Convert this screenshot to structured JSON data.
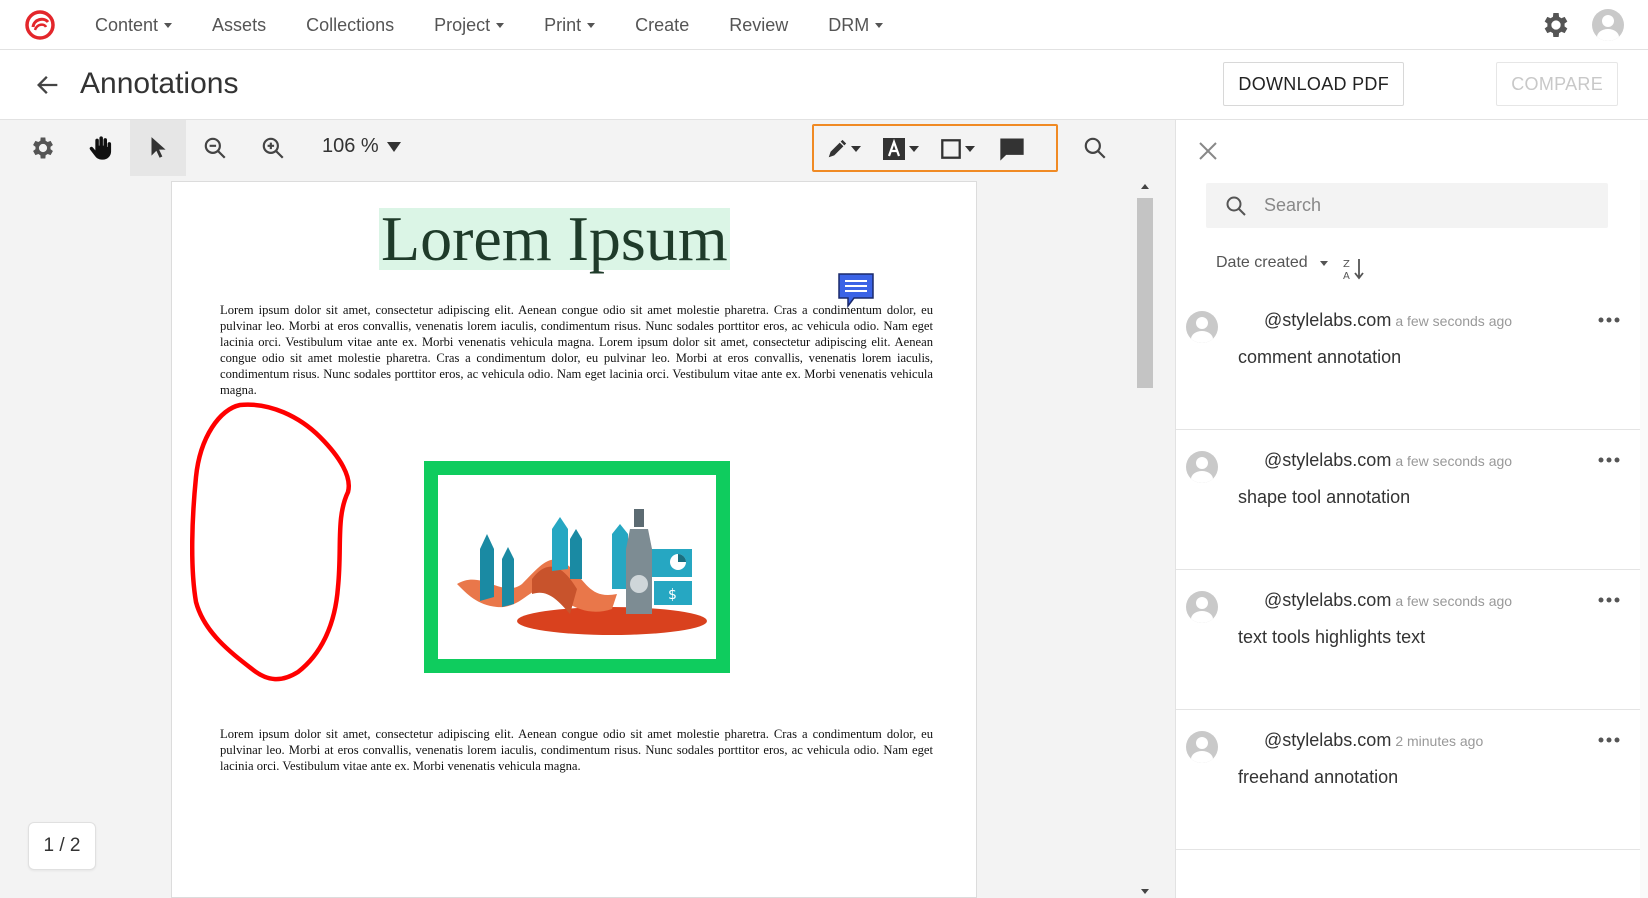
{
  "colors": {
    "logo": "#e3262b",
    "annotation_tools_border": "#f08a24",
    "highlight": "#dbf5e6",
    "freehand": "#ff0000",
    "shape_frame": "#0fcc5e",
    "comment_marker": "#3b63e6"
  },
  "nav": {
    "items": [
      {
        "label": "Content",
        "dropdown": true
      },
      {
        "label": "Assets",
        "dropdown": false
      },
      {
        "label": "Collections",
        "dropdown": false
      },
      {
        "label": "Project",
        "dropdown": true
      },
      {
        "label": "Print",
        "dropdown": true
      },
      {
        "label": "Create",
        "dropdown": false
      },
      {
        "label": "Review",
        "dropdown": false
      },
      {
        "label": "DRM",
        "dropdown": true
      }
    ],
    "icons": [
      "gear-icon",
      "user-avatar-icon"
    ]
  },
  "header": {
    "title": "Annotations",
    "download_label": "DOWNLOAD PDF",
    "compare_label": "COMPARE"
  },
  "toolbar": {
    "zoom": "106 %",
    "icons": [
      "gear-icon",
      "hand-icon",
      "pointer-icon",
      "zoom-out-icon",
      "zoom-in-icon",
      "pen-icon",
      "text-tool-icon",
      "rectangle-icon",
      "comment-icon",
      "search-icon"
    ]
  },
  "document": {
    "title": "Lorem Ipsum",
    "paragraph1": "Lorem ipsum dolor sit amet, consectetur adipiscing elit. Aenean congue odio sit amet molestie pharetra. Cras a condimentum dolor, eu pulvinar leo. Morbi at eros convallis, venenatis lorem iaculis, condimentum risus. Nunc sodales porttitor eros, ac vehicula odio. Nam eget lacinia orci. Vestibulum vitae ante ex. Morbi venenatis vehicula magna. Lorem ipsum dolor sit amet, consectetur adipiscing elit. Aenean congue odio sit amet molestie pharetra. Cras a condimentum dolor, eu pulvinar leo. Morbi at eros convallis, venenatis lorem iaculis, condimentum risus. Nunc sodales porttitor eros, ac vehicula odio. Nam eget lacinia orci. Vestibulum vitae ante ex. Morbi venenatis vehicula magna.",
    "paragraph2": "Lorem ipsum dolor sit amet, consectetur adipiscing elit. Aenean congue odio sit amet molestie pharetra. Cras a condimentum dolor, eu pulvinar leo. Morbi at eros convallis, venenatis lorem iaculis, condimentum risus. Nunc sodales porttitor eros, ac vehicula odio. Nam eget lacinia orci. Vestibulum vitae ante ex. Morbi venenatis vehicula magna."
  },
  "pager": "1 / 2",
  "panel": {
    "search_placeholder": "Search",
    "sort_label": "Date created",
    "comments": [
      {
        "user": "@stylelabs.com",
        "time": "a few seconds ago",
        "text": "comment annotation"
      },
      {
        "user": "@stylelabs.com",
        "time": "a few seconds ago",
        "text": "shape tool annotation"
      },
      {
        "user": "@stylelabs.com",
        "time": "a few seconds ago",
        "text": "text tools highlights text"
      },
      {
        "user": "@stylelabs.com",
        "time": "2 minutes ago",
        "text": "freehand annotation"
      }
    ]
  }
}
